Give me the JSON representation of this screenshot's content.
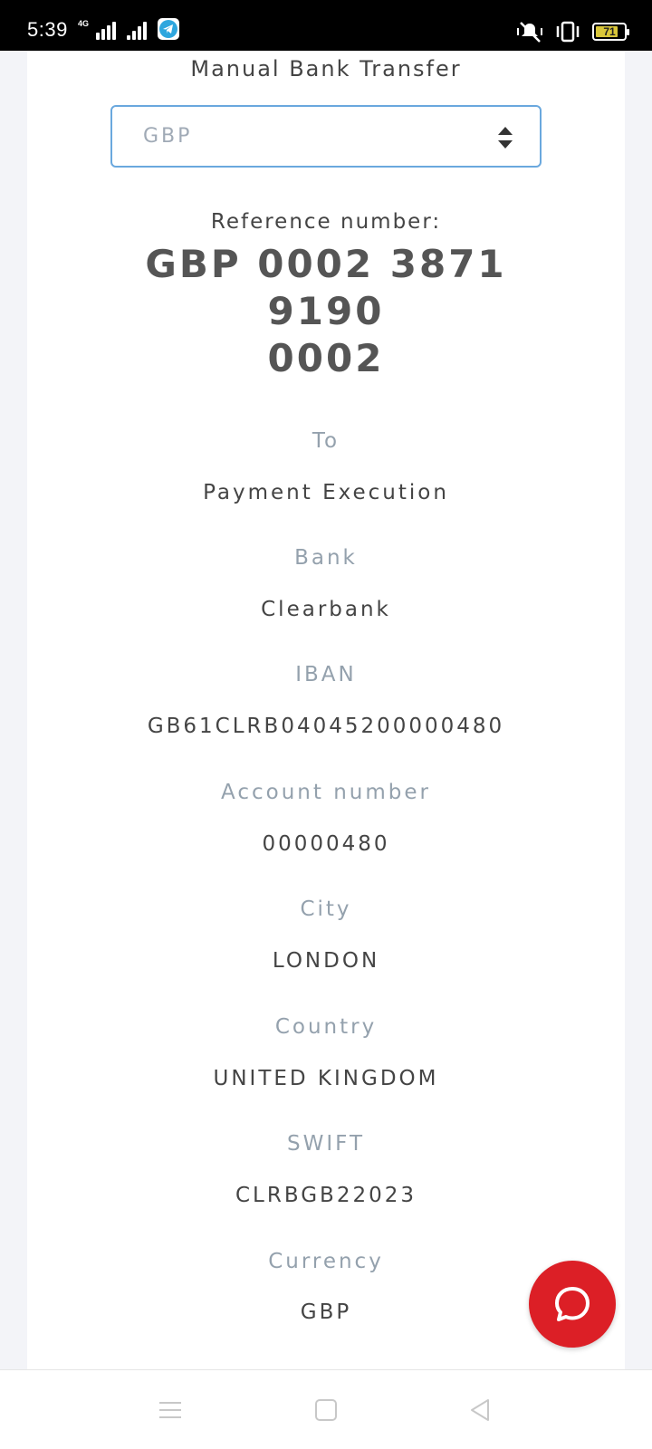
{
  "status_bar": {
    "time": "5:39",
    "network": "4G",
    "battery": "71"
  },
  "page": {
    "title": "Manual Bank Transfer"
  },
  "currency_select": {
    "value": "GBP"
  },
  "reference": {
    "label": "Reference number:",
    "line1": "GBP 0002 3871 9190",
    "line2": "0002"
  },
  "details": [
    {
      "label": "To",
      "value": "Payment Execution"
    },
    {
      "label": "Bank",
      "value": "Clearbank"
    },
    {
      "label": "IBAN",
      "value": "GB61CLRB04045200000480"
    },
    {
      "label": "Account number",
      "value": "00000480"
    },
    {
      "label": "City",
      "value": "LONDON"
    },
    {
      "label": "Country",
      "value": "UNITED KINGDOM"
    },
    {
      "label": "SWIFT",
      "value": "CLRBGB22023"
    },
    {
      "label": "Currency",
      "value": "GBP"
    }
  ],
  "colors": {
    "accent_border": "#6aa8de",
    "chat_button": "#dc1f26",
    "label_gray": "#94a1ad",
    "value_dark": "#444444"
  },
  "icons": {
    "chat": "chat-bubble-icon",
    "nav_menu": "menu-icon",
    "nav_home": "home-square-icon",
    "nav_back": "back-triangle-icon"
  }
}
